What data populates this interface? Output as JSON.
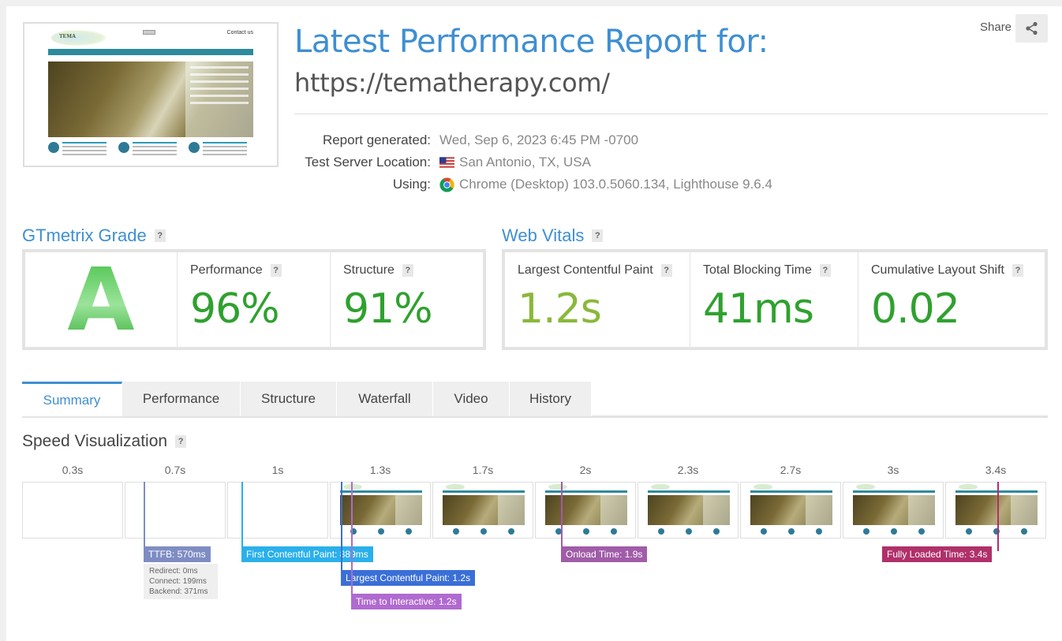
{
  "thumbnail": {
    "logo_text": "TEMA",
    "contact": "Contact us"
  },
  "header": {
    "title": "Latest Performance Report for:",
    "url": "https://tematherapy.com/",
    "share_label": "Share"
  },
  "meta": {
    "generated_label": "Report generated:",
    "generated_value": "Wed, Sep 6, 2023 6:45 PM -0700",
    "location_label": "Test Server Location:",
    "location_value": "San Antonio, TX, USA",
    "using_label": "Using:",
    "using_value": "Chrome (Desktop) 103.0.5060.134, Lighthouse 9.6.4"
  },
  "grade": {
    "title": "GTmetrix Grade",
    "letter": "A",
    "performance_label": "Performance",
    "performance_value": "96%",
    "structure_label": "Structure",
    "structure_value": "91%"
  },
  "vitals": {
    "title": "Web Vitals",
    "lcp_label": "Largest Contentful Paint",
    "lcp_value": "1.2s",
    "tbt_label": "Total Blocking Time",
    "tbt_value": "41ms",
    "cls_label": "Cumulative Layout Shift",
    "cls_value": "0.02"
  },
  "colors": {
    "accent": "#3f8fd2",
    "good": "#2fa12f",
    "ok": "#8ab83a"
  },
  "tabs": [
    {
      "label": "Summary",
      "active": true
    },
    {
      "label": "Performance",
      "active": false
    },
    {
      "label": "Structure",
      "active": false
    },
    {
      "label": "Waterfall",
      "active": false
    },
    {
      "label": "Video",
      "active": false
    },
    {
      "label": "History",
      "active": false
    }
  ],
  "speed": {
    "title": "Speed Visualization",
    "help": "?",
    "frames": [
      {
        "time": "0.3s",
        "loaded": false
      },
      {
        "time": "0.7s",
        "loaded": false
      },
      {
        "time": "1s",
        "loaded": false
      },
      {
        "time": "1.3s",
        "loaded": true
      },
      {
        "time": "1.7s",
        "loaded": true
      },
      {
        "time": "2s",
        "loaded": true
      },
      {
        "time": "2.3s",
        "loaded": true
      },
      {
        "time": "2.7s",
        "loaded": true
      },
      {
        "time": "3s",
        "loaded": true
      },
      {
        "time": "3.4s",
        "loaded": true
      }
    ],
    "markers": {
      "ttfb": "TTFB: 570ms",
      "fcp": "First Contentful Paint: 889ms",
      "lcp": "Largest Contentful Paint: 1.2s",
      "tti": "Time to Interactive: 1.2s",
      "onload": "Onload Time: 1.9s",
      "fully": "Fully Loaded Time: 3.4s"
    },
    "ttfb_detail": {
      "redirect": "Redirect: 0ms",
      "connect": "Connect: 199ms",
      "backend": "Backend: 371ms"
    }
  }
}
